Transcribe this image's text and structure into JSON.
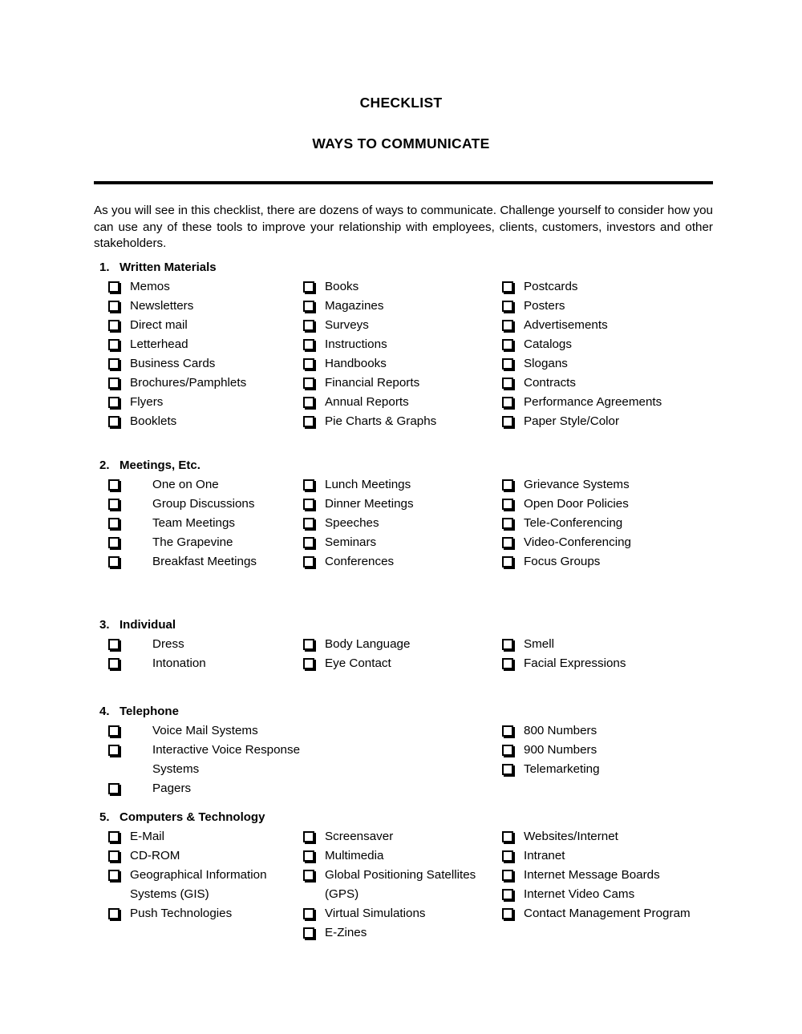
{
  "document": {
    "title": "CHECKLIST",
    "subtitle": "WAYS TO COMMUNICATE",
    "intro": "As you will see in this checklist, there are dozens of ways to communicate. Challenge yourself to consider how you can use any of these tools to improve your relationship with employees, clients, customers, investors and other stakeholders."
  },
  "checkbox_icon": "empty-checkbox",
  "colors": {
    "text": "#000000",
    "background": "#ffffff",
    "rule": "#000000"
  },
  "sections": [
    {
      "number": "1.",
      "heading": "Written Materials",
      "col1_indent": "narrow",
      "columns": [
        [
          "Memos",
          "Newsletters",
          "Direct mail",
          "Letterhead",
          "Business Cards",
          "Brochures/Pamphlets",
          "Flyers",
          "Booklets"
        ],
        [
          "Books",
          "Magazines",
          "Surveys",
          "Instructions",
          "Handbooks",
          "Financial Reports",
          "Annual Reports",
          "Pie Charts & Graphs"
        ],
        [
          "Postcards",
          "Posters",
          "Advertisements",
          "Catalogs",
          "Slogans",
          "Contracts",
          "Performance Agreements",
          "Paper Style/Color"
        ]
      ]
    },
    {
      "number": "2.",
      "heading": "Meetings, Etc.",
      "col1_indent": "wide",
      "columns": [
        [
          "One on One",
          "Group Discussions",
          "Team Meetings",
          "The Grapevine",
          "Breakfast Meetings"
        ],
        [
          "Lunch Meetings",
          "Dinner Meetings",
          "Speeches",
          "Seminars",
          "Conferences"
        ],
        [
          "Grievance Systems",
          "Open Door Policies",
          "Tele-Conferencing",
          "Video-Conferencing",
          "Focus Groups"
        ]
      ]
    },
    {
      "number": "3.",
      "heading": "Individual",
      "col1_indent": "wide",
      "columns": [
        [
          "Dress",
          "Intonation"
        ],
        [
          "Body Language",
          "Eye Contact"
        ],
        [
          "Smell",
          "Facial Expressions"
        ]
      ]
    },
    {
      "number": "4.",
      "heading": "Telephone",
      "col1_indent": "wide",
      "columns": [
        [
          "Voice Mail Systems",
          "Interactive Voice Response Systems",
          "Pagers"
        ],
        [],
        [
          "800 Numbers",
          "900 Numbers",
          "Telemarketing"
        ]
      ]
    },
    {
      "number": "5.",
      "heading": "Computers & Technology",
      "col1_indent": "narrow",
      "columns": [
        [
          "E-Mail",
          "CD-ROM",
          "Geographical Information Systems (GIS)",
          "Push Technologies"
        ],
        [
          "Screensaver",
          "Multimedia",
          "Global Positioning Satellites (GPS)",
          "Virtual Simulations",
          "E-Zines"
        ],
        [
          "Websites/Internet",
          "Intranet",
          "Internet Message Boards",
          "Internet Video Cams",
          "Contact Management Program"
        ]
      ]
    }
  ]
}
